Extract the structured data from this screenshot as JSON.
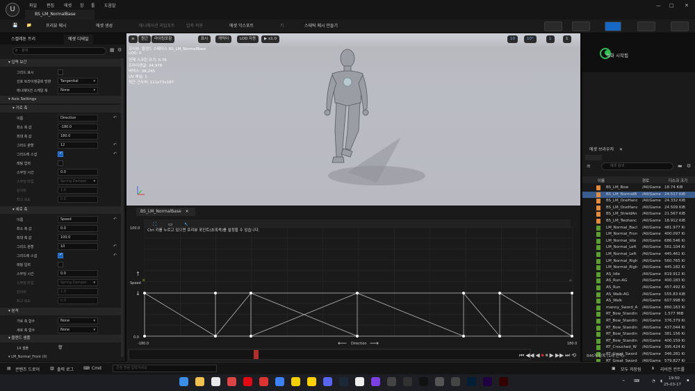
{
  "menubar": {
    "logo": "U",
    "items": [
      "파일",
      "편집",
      "에셋",
      "창",
      "툴",
      "도움말"
    ],
    "tab_title": "BS_LM_NormalBase",
    "window_buttons": [
      "—",
      "□",
      "✕"
    ]
  },
  "toolbar": {
    "items": [
      {
        "label": "프리뷰 메시",
        "dim": false
      },
      {
        "label": "에셋 생성",
        "dim": false
      },
      {
        "label": "애니메이션 리임포트",
        "dim": true
      },
      {
        "label": "압축 적용",
        "dim": true
      },
      {
        "label": "에셋 익스포트",
        "dim": false
      },
      {
        "label": "키",
        "dim": true
      },
      {
        "label": "스태틱 메시 만들기",
        "dim": false
      }
    ]
  },
  "left_panel": {
    "tabs": [
      "스켈레톤 트리",
      "에셋 디테일"
    ],
    "search_placeholder": "검색",
    "sections": {
      "input_interp": "입력 보간",
      "axis_settings": "Axis Settings",
      "horizontal": "가로 축",
      "vertical": "세로 축",
      "analysis": "분석",
      "samples": "블렌드 샘플"
    },
    "rows_top": [
      {
        "label": "그리드 표시",
        "type": "check",
        "on": false
      },
      {
        "label": "선호 트라이앵글화 방향",
        "type": "dropdown",
        "value": "Tangential"
      },
      {
        "label": "애니메이션 스케일 축",
        "type": "dropdown",
        "value": "None"
      }
    ],
    "horizontal_rows": [
      {
        "label": "이름",
        "type": "text",
        "value": "Direction",
        "reset": true
      },
      {
        "label": "최소 축 값",
        "type": "text",
        "value": "-180.0"
      },
      {
        "label": "최대 축 값",
        "type": "text",
        "value": "180.0"
      },
      {
        "label": "그리드 분할",
        "type": "text",
        "value": "12",
        "reset": true
      },
      {
        "label": "그리드에 스냅",
        "type": "check",
        "on": true,
        "reset": true
      },
      {
        "label": "래핑 입력",
        "type": "check",
        "on": false
      },
      {
        "label": "스무딩 시간",
        "type": "text",
        "value": "0.0"
      },
      {
        "label": "스무딩 타입",
        "type": "dropdown",
        "value": "Spring Damper",
        "dim": true
      },
      {
        "label": "감쇠비",
        "type": "text",
        "value": "1.0",
        "dim": true
      },
      {
        "label": "최고 속도",
        "type": "text",
        "value": "0.0",
        "dim": true
      }
    ],
    "vertical_rows": [
      {
        "label": "이름",
        "type": "text",
        "value": "Speed",
        "reset": true
      },
      {
        "label": "최소 축 값",
        "type": "text",
        "value": "0.0"
      },
      {
        "label": "최대 축 값",
        "type": "text",
        "value": "100.0"
      },
      {
        "label": "그리드 분할",
        "type": "text",
        "value": "10",
        "reset": true
      },
      {
        "label": "그리드에 스냅",
        "type": "check",
        "on": true,
        "reset": true
      },
      {
        "label": "래핑 입력",
        "type": "check",
        "on": false
      },
      {
        "label": "스무딩 시간",
        "type": "text",
        "value": "0.0"
      },
      {
        "label": "스무딩 타입",
        "type": "dropdown",
        "value": "Spring Damper",
        "dim": true
      },
      {
        "label": "감쇠비",
        "type": "text",
        "value": "1.0",
        "dim": true
      },
      {
        "label": "최고 속도",
        "type": "text",
        "value": "0.0",
        "dim": true
      }
    ],
    "analysis_rows": [
      {
        "label": "가로 축 함수",
        "type": "dropdown",
        "value": "None"
      },
      {
        "label": "세로 축 함수",
        "type": "dropdown",
        "value": "None"
      }
    ],
    "samples_count": "14 샘플",
    "last_item": "LM_Normal_Front (0)"
  },
  "viewport": {
    "toolbar": [
      "≡",
      "원근",
      "라이팅포함",
      "표시",
      "캐릭터",
      "LOD 자동",
      "▶ x1.0"
    ],
    "right_controls": [
      "10",
      "10°",
      "1",
      "1"
    ],
    "info_lines": [
      "프리뷰: 블렌드 스페이스 BS_LM_NormalBase",
      "LOD: 0",
      "현재 스크린 크기: 0.76",
      "트라이앵글: 34,978",
      "버텍스: 38,245",
      "UV 채널: 1",
      "최근 근사치: 111x73x187"
    ]
  },
  "graph": {
    "tab": "BS_LM_NormalBase",
    "hint": "Ctrl 키를 누르고 있으면 프리뷰 포인트(초록색)를 설정할 수 있습니다.",
    "y_max_label": "100.0",
    "y_min_label": "0.0",
    "x_min_label": "-180.0",
    "x_max_label": "180.0",
    "x_axis_name": "Direction",
    "y_axis_name": "Speed",
    "playback_controls": [
      "⏮",
      "◀◀",
      "◀",
      "⏺",
      "⏸",
      "▶",
      "▶▶",
      "⏭",
      "⟲"
    ]
  },
  "record": {
    "label": "녹화 시작됨"
  },
  "asset_browser": {
    "tab": "에셋 브라우저",
    "search_placeholder": "에셋 검색",
    "columns": [
      "이름",
      "경로",
      "디스크 크기"
    ],
    "rows": [
      {
        "name": "BS_LM_Bow",
        "path": "/All/Game",
        "size": "18.74 KiB",
        "kind": "bs"
      },
      {
        "name": "BS_LM_NormalB",
        "path": "/All/Game",
        "size": "24.517 KiB",
        "kind": "bs",
        "selected": true
      },
      {
        "name": "BS_LM_OneHanc",
        "path": "/All/Game",
        "size": "24.332 KiB",
        "kind": "bs"
      },
      {
        "name": "BS_LM_OneHanc",
        "path": "/All/Game",
        "size": "24.509 KiB",
        "kind": "bs"
      },
      {
        "name": "BS_LM_ShieldAn",
        "path": "/All/Game",
        "size": "21.567 KiB",
        "kind": "bs"
      },
      {
        "name": "BS_LM_Twohanc",
        "path": "/All/Game",
        "size": "18.912 KiB",
        "kind": "bs"
      },
      {
        "name": "LM_Normal_Bacl",
        "path": "/All/Game",
        "size": "481.977 Ki",
        "kind": "anim"
      },
      {
        "name": "LM_Normal_Fron",
        "path": "/All/Game",
        "size": "400.097 Ki",
        "kind": "anim"
      },
      {
        "name": "LM_Normal_Idle",
        "path": "/All/Game",
        "size": "686.546 Ki",
        "kind": "anim"
      },
      {
        "name": "LM_Normal_Left",
        "path": "/All/Game",
        "size": "561.104 Ki",
        "kind": "anim"
      },
      {
        "name": "LM_Normal_Left",
        "path": "/All/Game",
        "size": "445.461 Ki",
        "kind": "anim"
      },
      {
        "name": "LM_Normal_Righ",
        "path": "/All/Game",
        "size": "560.765 Ki",
        "kind": "anim"
      },
      {
        "name": "LM_Normal_Righ",
        "path": "/All/Game",
        "size": "445.182 Ki",
        "kind": "anim"
      },
      {
        "name": "AS_Idle",
        "path": "/All/Game",
        "size": "819.912 Ki",
        "kind": "anim"
      },
      {
        "name": "AS_Run-AG",
        "path": "/All/Game",
        "size": "400.183 Ki",
        "kind": "anim"
      },
      {
        "name": "AS_Run",
        "path": "/All/Game",
        "size": "457.492 Ki",
        "kind": "anim"
      },
      {
        "name": "AS_Walk-AG",
        "path": "/All/Game",
        "size": "555.83 KiB",
        "kind": "anim"
      },
      {
        "name": "AS_Walk",
        "path": "/All/Game",
        "size": "607.998 Ki",
        "kind": "anim"
      },
      {
        "name": "manny_Sword_A",
        "path": "/All/Game",
        "size": "860.163 Ki",
        "kind": "anim"
      },
      {
        "name": "RT_Bow_Standin",
        "path": "/All/Game",
        "size": "1.577 MiB",
        "kind": "anim"
      },
      {
        "name": "RT_Bow_Standin",
        "path": "/All/Game",
        "size": "376.379 Ki",
        "kind": "anim"
      },
      {
        "name": "RT_Bow_Standin",
        "path": "/All/Game",
        "size": "437.044 Ki",
        "kind": "anim"
      },
      {
        "name": "RT_Bow_Standin",
        "path": "/All/Game",
        "size": "381.156 Ki",
        "kind": "anim"
      },
      {
        "name": "RT_Bow_Standin",
        "path": "/All/Game",
        "size": "400.159 Ki",
        "kind": "anim"
      },
      {
        "name": "RT_Crouched_W",
        "path": "/All/Game",
        "size": "395.424 Ki",
        "kind": "anim"
      },
      {
        "name": "RT_Great_Sword",
        "path": "/All/Game",
        "size": "346.281 Ki",
        "kind": "anim"
      },
      {
        "name": "RT_Great_Sword",
        "path": "/All/Game",
        "size": "579.827 Ki",
        "kind": "anim"
      },
      {
        "name": "RT_Great_Sword",
        "path": "/All/Game",
        "size": "1.098 MiB",
        "kind": "anim"
      },
      {
        "name": "RT_Great_Sword",
        "path": "/All/Game",
        "size": "333.313 Ki",
        "kind": "anim"
      },
      {
        "name": "RT_Great_Sword",
        "path": "/All/Game",
        "size": "309.415 Ki",
        "kind": "anim"
      }
    ],
    "footer": "846개 항목 (1개 선택)"
  },
  "statusbar": {
    "content_drawer": "콘텐츠 드로어",
    "output_log": "출력 로그",
    "cmd": "Cmd",
    "console_placeholder": "콘솔 명령 입력하세요",
    "save_all": "모두 저장됨",
    "revision": "리비전 컨트롤"
  },
  "taskbar": {
    "time": "19:50",
    "date": "25-03-17",
    "icons": [
      "windows",
      "explorer",
      "chrome",
      "app",
      "netflix",
      "app",
      "photos",
      "kakao",
      "app",
      "discord",
      "steam",
      "notion",
      "app",
      "app",
      "epic",
      "unreal",
      "app",
      "app",
      "photoshop",
      "aftereffects",
      "illustrator"
    ]
  },
  "colors": {
    "accent": "#1c5fb8",
    "record": "#2fbe53",
    "bs_icon": "#e58a3a",
    "anim_icon": "#5aa02c",
    "scrubber": "#b32f2a"
  }
}
